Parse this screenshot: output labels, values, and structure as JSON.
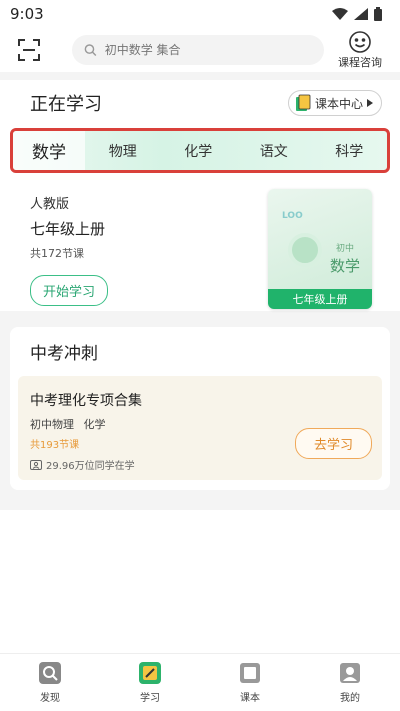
{
  "status_bar": {
    "time": "9:03"
  },
  "search": {
    "placeholder": "初中数学 集合"
  },
  "consult": {
    "label": "课程咨询"
  },
  "study": {
    "title": "正在学习",
    "book_center": "课本中心"
  },
  "tabs": [
    {
      "label": "数学",
      "active": true
    },
    {
      "label": "物理"
    },
    {
      "label": "化学"
    },
    {
      "label": "语文"
    },
    {
      "label": "科学"
    }
  ],
  "course": {
    "edition": "人教版",
    "grade": "七年级上册",
    "count": "共172节课",
    "start_label": "开始学习",
    "cover": {
      "logo": "LOO",
      "sub_small": "初中",
      "sub_big": "数学",
      "ribbon": "七年级上册"
    }
  },
  "exam": {
    "title": "中考冲刺",
    "pack": {
      "name": "中考理化专项合集",
      "subjects": "初中物理 化学",
      "count": "共193节课",
      "learners": "29.96万位同学在学",
      "go_label": "去学习"
    }
  },
  "nav": [
    {
      "label": "发现",
      "icon": "discover-icon"
    },
    {
      "label": "学习",
      "icon": "study-icon"
    },
    {
      "label": "课本",
      "icon": "textbook-icon"
    },
    {
      "label": "我的",
      "icon": "profile-icon"
    }
  ],
  "colors": {
    "accent": "#20b36b",
    "highlight_border": "#d9403a",
    "orange": "#e08a2a"
  }
}
